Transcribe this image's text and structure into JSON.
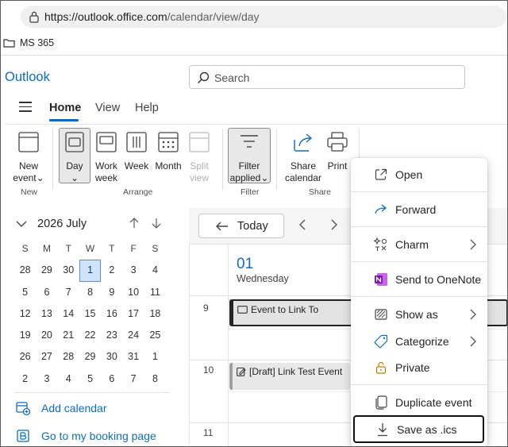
{
  "browser": {
    "url_host": "https://outlook.office.com",
    "url_path": "/calendar/view/day",
    "bookmark": "MS 365"
  },
  "app": {
    "name": "Outlook"
  },
  "search": {
    "placeholder": "Search"
  },
  "tabs": [
    {
      "label": "Home",
      "active": true
    },
    {
      "label": "View",
      "active": false
    },
    {
      "label": "Help",
      "active": false
    }
  ],
  "ribbon": {
    "new_event": [
      "New",
      "event"
    ],
    "day": "Day",
    "work_week": [
      "Work",
      "week"
    ],
    "week": "Week",
    "month": "Month",
    "split_view": [
      "Split",
      "view"
    ],
    "filter": [
      "Filter",
      "applied"
    ],
    "share": [
      "Share",
      "calendar"
    ],
    "print": "Print",
    "groups": {
      "new": "New",
      "arrange": "Arrange",
      "filter": "Filter",
      "share": "Share"
    }
  },
  "mini_calendar": {
    "title": "2026 July",
    "weekdays": [
      "S",
      "M",
      "T",
      "W",
      "T",
      "F",
      "S"
    ],
    "weeks": [
      [
        "28",
        "29",
        "30",
        "1",
        "2",
        "3",
        "4"
      ],
      [
        "5",
        "6",
        "7",
        "8",
        "9",
        "10",
        "11"
      ],
      [
        "12",
        "13",
        "14",
        "15",
        "16",
        "17",
        "18"
      ],
      [
        "19",
        "20",
        "21",
        "22",
        "23",
        "24",
        "25"
      ],
      [
        "26",
        "27",
        "28",
        "29",
        "30",
        "31",
        "1"
      ],
      [
        "2",
        "3",
        "4",
        "5",
        "6",
        "7",
        "8"
      ]
    ],
    "selected": "1"
  },
  "sidebar": {
    "add_calendar": "Add calendar",
    "booking_page": "Go to my booking page"
  },
  "calendar": {
    "today": "Today",
    "day_number": "01",
    "day_name": "Wednesday",
    "hours": [
      "9",
      "10",
      "11"
    ],
    "events": [
      {
        "title": "Event to Link To",
        "selected": true
      },
      {
        "title": "[Draft] Link Test Event",
        "selected": false
      }
    ]
  },
  "context_menu": {
    "items": [
      {
        "label": "Open",
        "icon": "open-external-icon"
      },
      {
        "label": "Forward",
        "icon": "forward-arrow-icon"
      },
      {
        "label": "Charm",
        "icon": "charm-icon",
        "submenu": true
      },
      {
        "label": "Send to OneNote",
        "icon": "onenote-icon"
      },
      {
        "label": "Show as",
        "icon": "show-as-icon",
        "submenu": true
      },
      {
        "label": "Categorize",
        "icon": "tag-icon",
        "submenu": true
      },
      {
        "label": "Private",
        "icon": "lock-icon"
      },
      {
        "label": "Duplicate event",
        "icon": "duplicate-icon"
      },
      {
        "label": "Save as .ics",
        "icon": "download-icon",
        "focused": true
      }
    ]
  },
  "colors": {
    "accent": "#0f6cbd",
    "onenote": "#7719aa"
  }
}
